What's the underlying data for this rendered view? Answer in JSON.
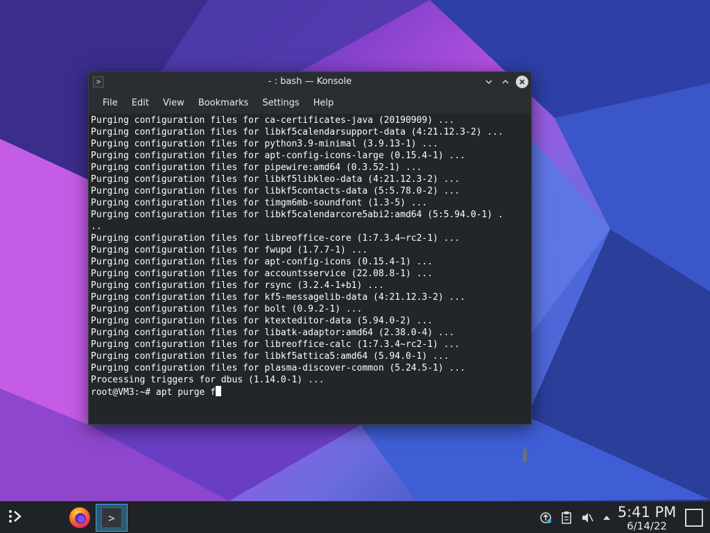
{
  "window": {
    "title": "- : bash — Konsole",
    "app_icon_glyph": ">"
  },
  "menu": [
    "File",
    "Edit",
    "View",
    "Bookmarks",
    "Settings",
    "Help"
  ],
  "terminal": {
    "lines": [
      "Purging configuration files for ca-certificates-java (20190909) ...",
      "Purging configuration files for libkf5calendarsupport-data (4:21.12.3-2) ...",
      "Purging configuration files for python3.9-minimal (3.9.13-1) ...",
      "Purging configuration files for apt-config-icons-large (0.15.4-1) ...",
      "Purging configuration files for pipewire:amd64 (0.3.52-1) ...",
      "Purging configuration files for libkf5libkleo-data (4:21.12.3-2) ...",
      "Purging configuration files for libkf5contacts-data (5:5.78.0-2) ...",
      "Purging configuration files for timgm6mb-soundfont (1.3-5) ...",
      "Purging configuration files for libkf5calendarcore5abi2:amd64 (5:5.94.0-1) .",
      "..",
      "Purging configuration files for libreoffice-core (1:7.3.4~rc2-1) ...",
      "Purging configuration files for fwupd (1.7.7-1) ...",
      "Purging configuration files for apt-config-icons (0.15.4-1) ...",
      "Purging configuration files for accountsservice (22.08.8-1) ...",
      "Purging configuration files for rsync (3.2.4-1+b1) ...",
      "Purging configuration files for kf5-messagelib-data (4:21.12.3-2) ...",
      "Purging configuration files for bolt (0.9.2-1) ...",
      "Purging configuration files for ktexteditor-data (5.94.0-2) ...",
      "Purging configuration files for libatk-adaptor:amd64 (2.38.0-4) ...",
      "Purging configuration files for libreoffice-calc (1:7.3.4~rc2-1) ...",
      "Purging configuration files for libkf5attica5:amd64 (5.94.0-1) ...",
      "Purging configuration files for plasma-discover-common (5.24.5-1) ...",
      "Processing triggers for dbus (1.14.0-1) ..."
    ],
    "prompt": "root@VM3:~# apt purge f"
  },
  "taskbar": {
    "time": "5:41 PM",
    "date": "6/14/22"
  },
  "colors": {
    "terminal_bg": "#232629",
    "terminal_fg": "#fcfcfc",
    "titlebar_bg": "#2a2e32",
    "taskbar_bg": "#1f2226",
    "accent": "#3daee9"
  }
}
